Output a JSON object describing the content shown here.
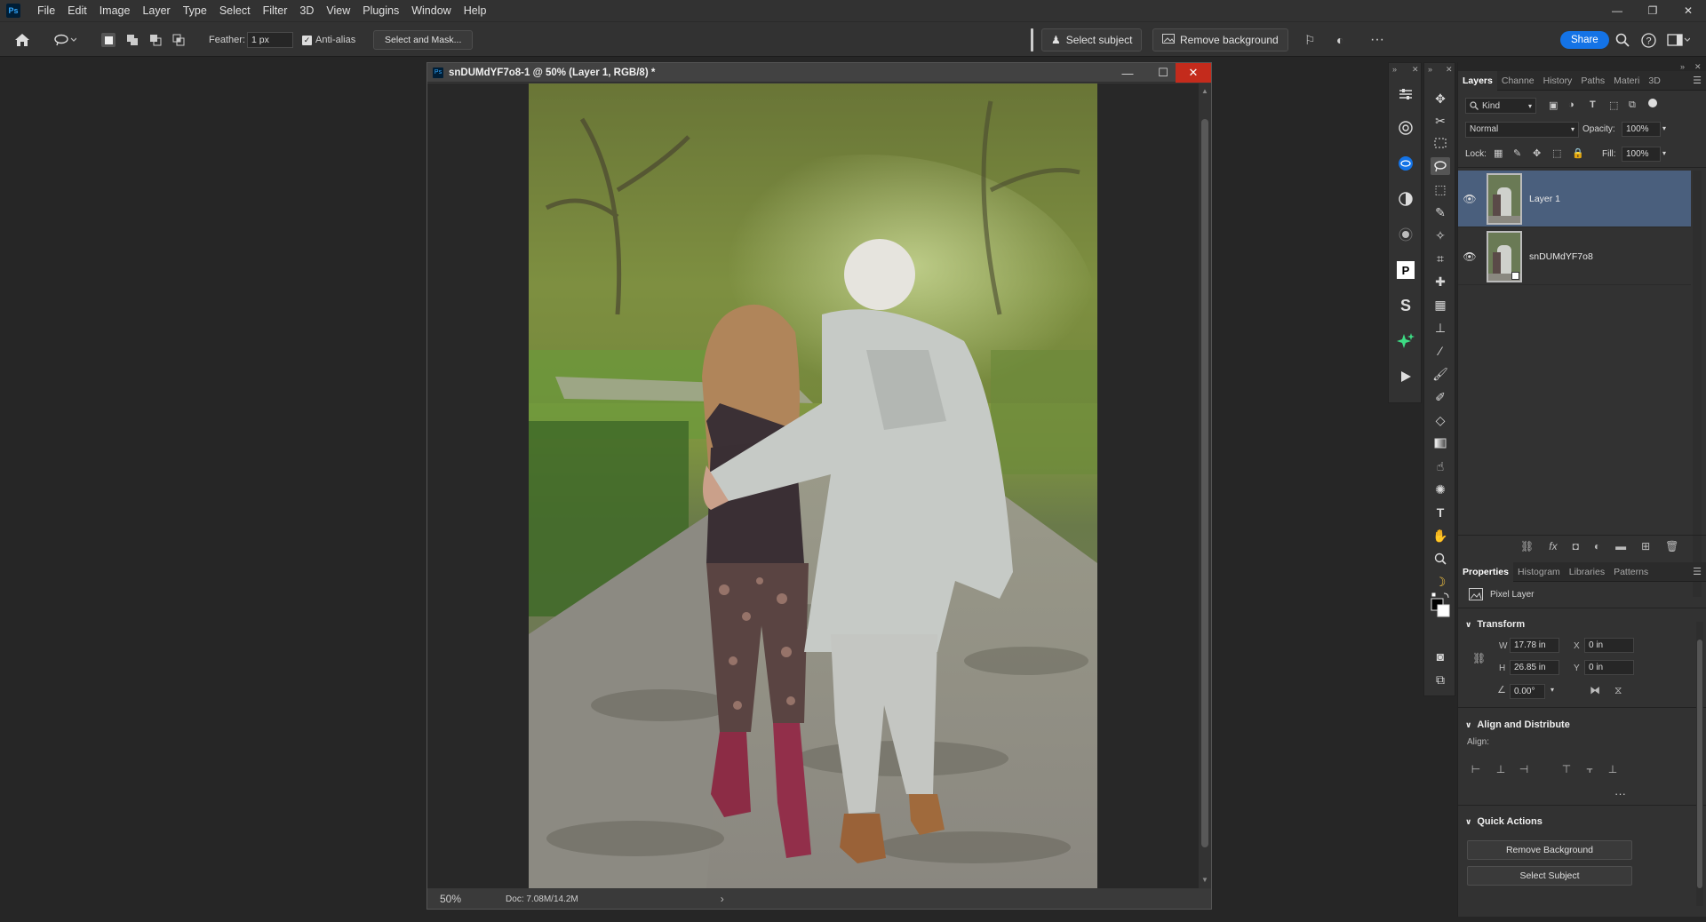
{
  "menu": {
    "logo": "Ps",
    "items": [
      "File",
      "Edit",
      "Image",
      "Layer",
      "Type",
      "Select",
      "Filter",
      "3D",
      "View",
      "Plugins",
      "Window",
      "Help"
    ],
    "minimize": "—",
    "restore": "❐",
    "close": "✕"
  },
  "options": {
    "feather_label": "Feather:",
    "feather_value": "1 px",
    "antialias_label": "Anti-alias",
    "select_mask": "Select and Mask...",
    "select_subject": "Select subject",
    "remove_background": "Remove background",
    "share": "Share"
  },
  "document": {
    "title": "snDUMdYF7o8-1 @ 50% (Layer 1, RGB/8) *",
    "zoom": "50%",
    "doc_info": "Doc: 7.08M/14.2M"
  },
  "layers_panel": {
    "tabs": [
      "Layers",
      "Channe",
      "History",
      "Paths",
      "Materi",
      "3D"
    ],
    "kind_label": "Kind",
    "blend_mode": "Normal",
    "opacity_label": "Opacity:",
    "opacity_value": "100%",
    "lock_label": "Lock:",
    "fill_label": "Fill:",
    "fill_value": "100%",
    "layers": [
      {
        "name": "Layer 1",
        "selected": true
      },
      {
        "name": "snDUMdYF7o8",
        "selected": false
      }
    ]
  },
  "properties_panel": {
    "tabs": [
      "Properties",
      "Histogram",
      "Libraries",
      "Patterns"
    ],
    "layer_type": "Pixel Layer",
    "transform_title": "Transform",
    "w_label": "W",
    "w_value": "17.78 in",
    "h_label": "H",
    "h_value": "26.85 in",
    "x_label": "X",
    "x_value": "0 in",
    "y_label": "Y",
    "y_value": "0 in",
    "angle_value": "0.00°",
    "align_title": "Align and Distribute",
    "align_label": "Align:",
    "quick_actions_title": "Quick Actions",
    "remove_bg_btn": "Remove Background",
    "select_subject_btn": "Select Subject"
  }
}
